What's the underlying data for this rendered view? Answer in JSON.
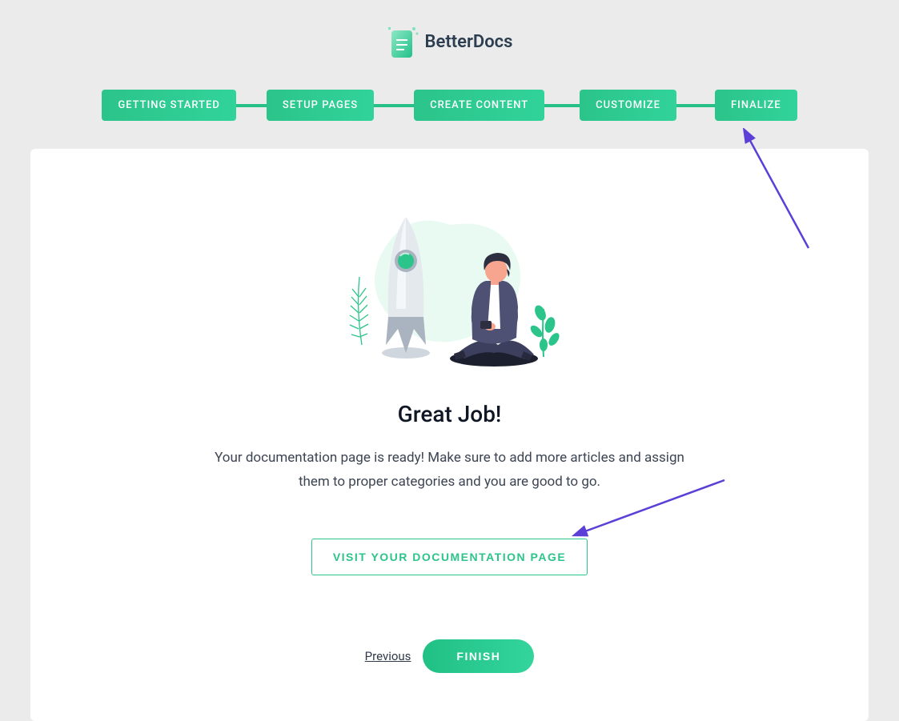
{
  "brand": {
    "name": "BetterDocs"
  },
  "steps": [
    "GETTING STARTED",
    "SETUP PAGES",
    "CREATE CONTENT",
    "CUSTOMIZE",
    "FINALIZE"
  ],
  "main": {
    "title": "Great Job!",
    "subtitle": "Your documentation page is ready! Make sure to add more articles and assign them to proper categories and you are good to go.",
    "visit_label": "VISIT YOUR DOCUMENTATION PAGE"
  },
  "footer": {
    "previous_label": "Previous",
    "finish_label": "FINISH"
  }
}
